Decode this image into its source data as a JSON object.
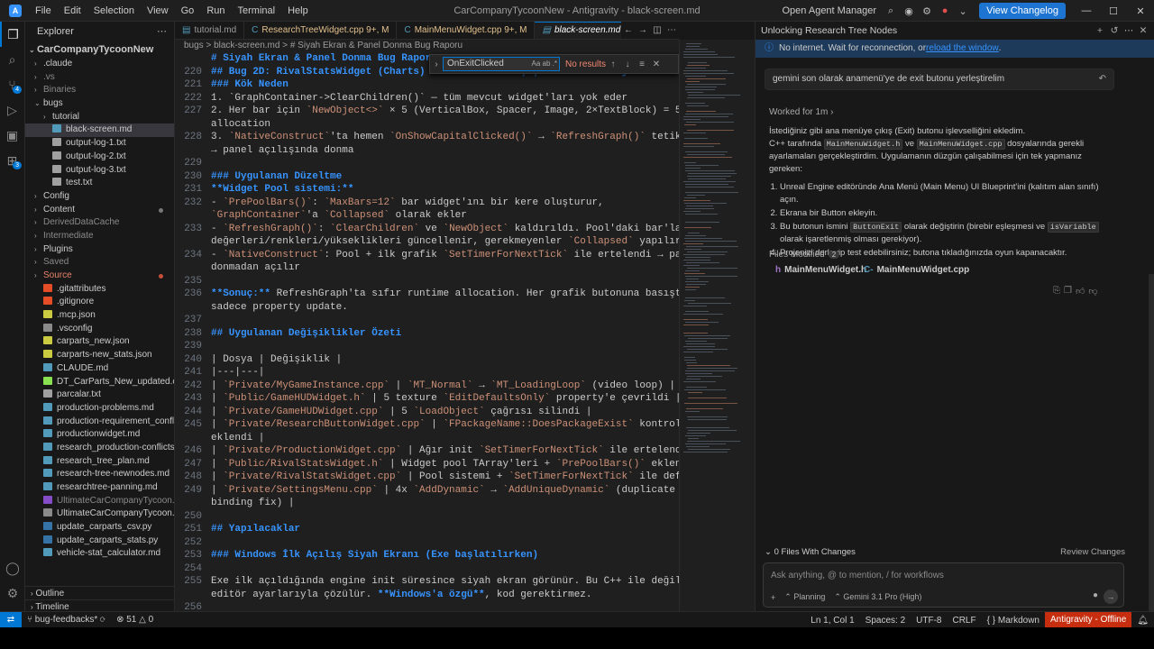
{
  "titlebar": {
    "menu": [
      "File",
      "Edit",
      "Selection",
      "View",
      "Go",
      "Run",
      "Terminal",
      "Help"
    ],
    "window_title": "CarCompanyTycoonNew - Antigravity - black-screen.md",
    "agent_manager": "Open Agent Manager",
    "changelog_button": "View Changelog"
  },
  "explorer": {
    "title": "Explorer",
    "root": "CarCompanyTycoonNew",
    "items": [
      {
        "label": ".claude",
        "type": "folder",
        "indent": 1,
        "state": "collapsed"
      },
      {
        "label": ".vs",
        "type": "folder",
        "indent": 1,
        "state": "collapsed",
        "dim": true
      },
      {
        "label": "Binaries",
        "type": "folder",
        "indent": 1,
        "state": "collapsed",
        "dim": true
      },
      {
        "label": "bugs",
        "type": "folder",
        "indent": 1,
        "state": "expanded"
      },
      {
        "label": "tutorial",
        "type": "folder",
        "indent": 2,
        "state": "collapsed"
      },
      {
        "label": "black-screen.md",
        "type": "md",
        "indent": 2,
        "active": true
      },
      {
        "label": "output-log-1.txt",
        "type": "txt",
        "indent": 2
      },
      {
        "label": "output-log-2.txt",
        "type": "txt",
        "indent": 2
      },
      {
        "label": "output-log-3.txt",
        "type": "txt",
        "indent": 2
      },
      {
        "label": "test.txt",
        "type": "txt",
        "indent": 2
      },
      {
        "label": "Config",
        "type": "folder",
        "indent": 1,
        "state": "collapsed"
      },
      {
        "label": "Content",
        "type": "folder",
        "indent": 1,
        "state": "collapsed",
        "dot": true
      },
      {
        "label": "DerivedDataCache",
        "type": "folder",
        "indent": 1,
        "state": "collapsed",
        "dim": true
      },
      {
        "label": "Intermediate",
        "type": "folder",
        "indent": 1,
        "state": "collapsed",
        "dim": true
      },
      {
        "label": "Plugins",
        "type": "folder",
        "indent": 1,
        "state": "collapsed"
      },
      {
        "label": "Saved",
        "type": "folder",
        "indent": 1,
        "state": "collapsed",
        "dim": true
      },
      {
        "label": "Source",
        "type": "folder",
        "indent": 1,
        "state": "collapsed",
        "red": true
      },
      {
        "label": ".gitattributes",
        "type": "git",
        "indent": 1
      },
      {
        "label": ".gitignore",
        "type": "git",
        "indent": 1
      },
      {
        "label": ".mcp.json",
        "type": "json",
        "indent": 1
      },
      {
        "label": ".vsconfig",
        "type": "cfg",
        "indent": 1
      },
      {
        "label": "carparts_new.json",
        "type": "json",
        "indent": 1
      },
      {
        "label": "carparts-new_stats.json",
        "type": "json",
        "indent": 1
      },
      {
        "label": "CLAUDE.md",
        "type": "md",
        "indent": 1
      },
      {
        "label": "DT_CarParts_New_updated.csv",
        "type": "csv",
        "indent": 1
      },
      {
        "label": "parcalar.txt",
        "type": "txt",
        "indent": 1
      },
      {
        "label": "production-problems.md",
        "type": "md",
        "indent": 1
      },
      {
        "label": "production-requirement_conflict...",
        "type": "md",
        "indent": 1
      },
      {
        "label": "productionwidget.md",
        "type": "md",
        "indent": 1
      },
      {
        "label": "research_production-conflicts.md",
        "type": "md",
        "indent": 1
      },
      {
        "label": "research_tree_plan.md",
        "type": "md",
        "indent": 1
      },
      {
        "label": "research-tree-newnodes.md",
        "type": "md",
        "indent": 1
      },
      {
        "label": "researchtree-panning.md",
        "type": "md",
        "indent": 1
      },
      {
        "label": "UltimateCarCompanyTycoon.sln",
        "type": "sln",
        "indent": 1,
        "dim": true
      },
      {
        "label": "UltimateCarCompanyTycoon.upr...",
        "type": "cfg",
        "indent": 1
      },
      {
        "label": "update_carparts_csv.py",
        "type": "py",
        "indent": 1
      },
      {
        "label": "update_carparts_stats.py",
        "type": "py",
        "indent": 1
      },
      {
        "label": "vehicle-stat_calculator.md",
        "type": "md",
        "indent": 1
      }
    ],
    "outline": "Outline",
    "timeline": "Timeline"
  },
  "editor": {
    "tabs": [
      {
        "label": "tutorial.md",
        "icon": "md"
      },
      {
        "label": "ResearchTreeWidget.cpp 9+, M",
        "icon": "cpp",
        "modified": true
      },
      {
        "label": "MainMenuWidget.cpp 9+, M",
        "icon": "cpp",
        "modified": true
      },
      {
        "label": "black-screen.md",
        "icon": "md",
        "active": true
      },
      {
        "label": "Ma",
        "icon": "h"
      }
    ],
    "breadcrumb": "bugs > black-screen.md > # Siyah Ekran & Panel Donma Bug Raporu",
    "lines": [
      {
        "n": "",
        "segs": [
          {
            "t": "# Siyah Ekran & Panel Donma Bug Raporu",
            "c": "h"
          }
        ]
      },
      {
        "n": "220",
        "segs": [
          {
            "t": "## Bug 2D: RivalStatsWidget (Charts) — Her Grafik Geçişinde 50+ NewObject",
            "c": "h"
          }
        ]
      },
      {
        "n": "221",
        "segs": [
          {
            "t": "### Kök Neden",
            "c": "h"
          }
        ]
      },
      {
        "n": "222",
        "segs": [
          {
            "t": "1. `GraphContainer->ClearChildren()` — tüm mevcut widget'ları yok eder"
          }
        ]
      },
      {
        "n": "227",
        "segs": [
          {
            "t": "2. Her bar için "
          },
          {
            "t": "`NewObject<>`",
            "c": "ic"
          },
          {
            "t": " × 5 (VerticalBox, Spacer, Image, 2×TextBlock) = 50+"
          }
        ]
      },
      {
        "n": "",
        "segs": [
          {
            "t": "allocation"
          }
        ]
      },
      {
        "n": "228",
        "segs": [
          {
            "t": "3. "
          },
          {
            "t": "`NativeConstruct`",
            "c": "ic"
          },
          {
            "t": "'ta hemen "
          },
          {
            "t": "`OnShowCapitalClicked()`",
            "c": "ic"
          },
          {
            "t": " → "
          },
          {
            "t": "`RefreshGraph()`",
            "c": "ic"
          },
          {
            "t": " tetiklenir"
          }
        ]
      },
      {
        "n": "",
        "segs": [
          {
            "t": "→ panel açılışında donma"
          }
        ]
      },
      {
        "n": "229",
        "segs": [
          {
            "t": ""
          }
        ]
      },
      {
        "n": "230",
        "segs": [
          {
            "t": "### Uygulanan Düzeltme",
            "c": "h"
          }
        ]
      },
      {
        "n": "231",
        "segs": [
          {
            "t": "**Widget Pool sistemi:**",
            "c": "bold"
          }
        ]
      },
      {
        "n": "232",
        "segs": [
          {
            "t": "- "
          },
          {
            "t": "`PrePoolBars()`",
            "c": "ic"
          },
          {
            "t": ": "
          },
          {
            "t": "`MaxBars=12`",
            "c": "ic"
          },
          {
            "t": " bar widget'ını bir kere oluşturur,"
          }
        ]
      },
      {
        "n": "",
        "segs": [
          {
            "t": "`GraphContainer`",
            "c": "ic"
          },
          {
            "t": "'a "
          },
          {
            "t": "`Collapsed`",
            "c": "ic"
          },
          {
            "t": " olarak ekler"
          }
        ]
      },
      {
        "n": "233",
        "segs": [
          {
            "t": "- "
          },
          {
            "t": "`RefreshGraph()`",
            "c": "ic"
          },
          {
            "t": ": "
          },
          {
            "t": "`ClearChildren`",
            "c": "ic"
          },
          {
            "t": " ve "
          },
          {
            "t": "`NewObject`",
            "c": "ic"
          },
          {
            "t": " kaldırıldı. Pool'daki bar'ların"
          }
        ]
      },
      {
        "n": "",
        "segs": [
          {
            "t": "değerleri/renkleri/yükseklikleri güncellenir, gerekmeyenler "
          },
          {
            "t": "`Collapsed`",
            "c": "ic"
          },
          {
            "t": " yapılır"
          }
        ]
      },
      {
        "n": "234",
        "segs": [
          {
            "t": "- "
          },
          {
            "t": "`NativeConstruct`",
            "c": "ic"
          },
          {
            "t": ": Pool + ilk grafik "
          },
          {
            "t": "`SetTimerForNextTick`",
            "c": "ic"
          },
          {
            "t": " ile ertelendi → panel"
          }
        ]
      },
      {
        "n": "",
        "segs": [
          {
            "t": "donmadan açılır"
          }
        ]
      },
      {
        "n": "235",
        "segs": [
          {
            "t": ""
          }
        ]
      },
      {
        "n": "236",
        "segs": [
          {
            "t": "**Sonuç:**",
            "c": "bold"
          },
          {
            "t": " RefreshGraph'ta sıfır runtime allocation. Her grafik butonuna basışta"
          }
        ]
      },
      {
        "n": "",
        "segs": [
          {
            "t": "sadece property update."
          }
        ]
      },
      {
        "n": "237",
        "segs": [
          {
            "t": ""
          }
        ]
      },
      {
        "n": "238",
        "segs": [
          {
            "t": "## Uygulanan Değişiklikler Özeti",
            "c": "h"
          }
        ]
      },
      {
        "n": "239",
        "segs": [
          {
            "t": ""
          }
        ]
      },
      {
        "n": "240",
        "segs": [
          {
            "t": "| Dosya | Değişiklik |"
          }
        ]
      },
      {
        "n": "241",
        "segs": [
          {
            "t": "|---|---|"
          }
        ]
      },
      {
        "n": "242",
        "segs": [
          {
            "t": "| "
          },
          {
            "t": "`Private/MyGameInstance.cpp`",
            "c": "ic"
          },
          {
            "t": " | "
          },
          {
            "t": "`MT_Normal`",
            "c": "ic"
          },
          {
            "t": " → "
          },
          {
            "t": "`MT_LoadingLoop`",
            "c": "ic"
          },
          {
            "t": " (video loop) |"
          }
        ]
      },
      {
        "n": "243",
        "segs": [
          {
            "t": "| "
          },
          {
            "t": "`Public/GameHUDWidget.h`",
            "c": "ic"
          },
          {
            "t": " | 5 texture "
          },
          {
            "t": "`EditDefaultsOnly`",
            "c": "ic"
          },
          {
            "t": " property'e çevrildi |"
          }
        ]
      },
      {
        "n": "244",
        "segs": [
          {
            "t": "| "
          },
          {
            "t": "`Private/GameHUDWidget.cpp`",
            "c": "ic"
          },
          {
            "t": " | 5 "
          },
          {
            "t": "`LoadObject`",
            "c": "ic"
          },
          {
            "t": " çağrısı silindi |"
          }
        ]
      },
      {
        "n": "245",
        "segs": [
          {
            "t": "| "
          },
          {
            "t": "`Private/ResearchButtonWidget.cpp`",
            "c": "ic"
          },
          {
            "t": " | "
          },
          {
            "t": "`FPackageName::DoesPackageExist`",
            "c": "ic"
          },
          {
            "t": " kontrolü"
          }
        ]
      },
      {
        "n": "",
        "segs": [
          {
            "t": "eklendi |"
          }
        ]
      },
      {
        "n": "246",
        "segs": [
          {
            "t": "| "
          },
          {
            "t": "`Private/ProductionWidget.cpp`",
            "c": "ic"
          },
          {
            "t": " | Ağır init "
          },
          {
            "t": "`SetTimerForNextTick`",
            "c": "ic"
          },
          {
            "t": " ile ertelendi |"
          }
        ]
      },
      {
        "n": "247",
        "segs": [
          {
            "t": "| "
          },
          {
            "t": "`Public/RivalStatsWidget.h`",
            "c": "ic"
          },
          {
            "t": " | Widget pool TArray'leri + "
          },
          {
            "t": "`PrePoolBars()`",
            "c": "ic"
          },
          {
            "t": " eklendi |"
          }
        ]
      },
      {
        "n": "248",
        "segs": [
          {
            "t": "| "
          },
          {
            "t": "`Private/RivalStatsWidget.cpp`",
            "c": "ic"
          },
          {
            "t": " | Pool sistemi + "
          },
          {
            "t": "`SetTimerForNextTick`",
            "c": "ic"
          },
          {
            "t": " ile defer |"
          }
        ]
      },
      {
        "n": "249",
        "segs": [
          {
            "t": "| "
          },
          {
            "t": "`Private/SettingsMenu.cpp`",
            "c": "ic"
          },
          {
            "t": " | 4x "
          },
          {
            "t": "`AddDynamic`",
            "c": "ic"
          },
          {
            "t": " → "
          },
          {
            "t": "`AddUniqueDynamic`",
            "c": "ic"
          },
          {
            "t": " (duplicate"
          }
        ]
      },
      {
        "n": "",
        "segs": [
          {
            "t": "binding fix) |"
          }
        ]
      },
      {
        "n": "250",
        "segs": [
          {
            "t": ""
          }
        ]
      },
      {
        "n": "251",
        "segs": [
          {
            "t": "## Yapılacaklar",
            "c": "h"
          }
        ]
      },
      {
        "n": "252",
        "segs": [
          {
            "t": ""
          }
        ]
      },
      {
        "n": "253",
        "segs": [
          {
            "t": "### Windows İlk Açılış Siyah Ekranı (Exe başlatılırken)",
            "c": "h"
          }
        ]
      },
      {
        "n": "254",
        "segs": [
          {
            "t": ""
          }
        ]
      },
      {
        "n": "255",
        "segs": [
          {
            "t": "Exe ilk açıldığında engine init süresince siyah ekran görünür. Bu C++ ile değil,"
          }
        ]
      },
      {
        "n": "",
        "segs": [
          {
            "t": "editör ayarlarıyla çözülür. "
          },
          {
            "t": "**Windows'a özgü**",
            "c": "bold"
          },
          {
            "t": ", kod gerektirmez."
          }
        ]
      },
      {
        "n": "256",
        "segs": [
          {
            "t": ""
          }
        ]
      }
    ],
    "find": {
      "value": "OnExitClicked",
      "result": "No results"
    }
  },
  "agent_panel": {
    "title": "Unlocking Research Tree Nodes",
    "banner_text": "No internet. Wait for reconnection, or ",
    "banner_link": "reload the window",
    "banner_end": ".",
    "user_message": "gemini son olarak anamenü'ye de exit butonu yerleştirelim",
    "worked_for": "Worked for 1m",
    "answer_p1": "İstediğiniz gibi ana menüye çıkış (Exit) butonu işlevselliğini ekledim.",
    "answer_p2a": "C++ tarafında ",
    "answer_code1": "MainMenuWidget.h",
    "answer_p2b": " ve ",
    "answer_code2": "MainMenuWidget.cpp",
    "answer_p2c": " dosyalarında gerekli ayarlamaları gerçekleştirdim. Uygulamanın düzgün çalışabilmesi için tek yapmanız gereken:",
    "steps": [
      "Unreal Engine editöründe Ana Menü (Main Menu) UI Blueprint'ini (kalıtım alan sınıfı) açın.",
      "Ekrana bir Button ekleyin."
    ],
    "step3a": "Bu butonun ismini ",
    "step3_code1": "ButtonExit",
    "step3b": " olarak değiştirin (birebir eşleşmesi ve ",
    "step3_code2": "isVariable",
    "step3c": " olarak işaretlenmiş olması gerekiyor).",
    "step4": "Projenizi derleyip test edebilirsiniz; butona tıkladığınızda oyun kapanacaktır.",
    "files_modified_label": "Files Modified",
    "files_modified_count": "2",
    "file1": "MainMenuWidget.h",
    "file1_icon": "h",
    "file2": "MainMenuWidget.cpp",
    "file2_icon": "C-",
    "changes": "0 Files With Changes",
    "review": "Review Changes",
    "input_placeholder": "Ask anything, @ to mention, / for workflows",
    "mode": "Planning",
    "model": "Gemini 3.1 Pro (High)"
  },
  "statusbar": {
    "branch": "bug-feedbacks*",
    "errors": "51",
    "warnings": "0",
    "position": "Ln 1, Col 1",
    "spaces": "Spaces: 2",
    "encoding": "UTF-8",
    "eol": "CRLF",
    "language": "Markdown",
    "offline": "Antigravity - Offline"
  },
  "colors": {
    "accent": "#0078d4",
    "heading": "#3794ff",
    "inline_code": "#ce9178",
    "offline_badge": "#c72e0f"
  }
}
